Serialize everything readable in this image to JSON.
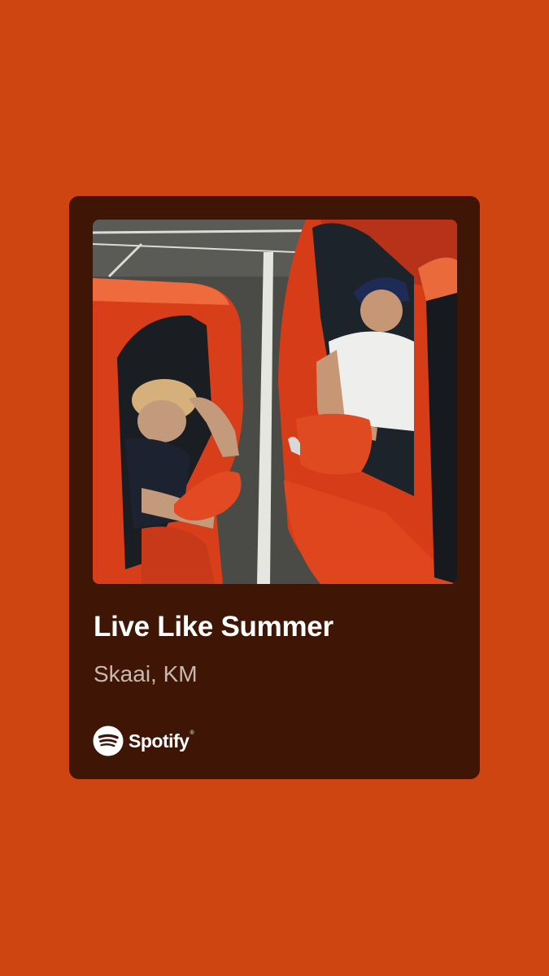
{
  "colors": {
    "background": "#cf4511",
    "card": "#3f1505",
    "title_text": "#ffffff",
    "artist_text": "#c9b8b0",
    "logo": "#ffffff"
  },
  "track": {
    "title": "Live Like Summer",
    "artists": "Skaai, KM"
  },
  "album_art": {
    "description_icon": "album-cover-photo"
  },
  "brand": {
    "icon": "spotify-logo-icon",
    "name": "Spotify"
  }
}
